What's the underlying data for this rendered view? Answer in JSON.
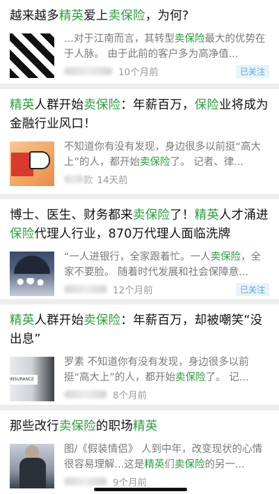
{
  "articles": [
    {
      "title_parts": [
        {
          "t": "越来越多",
          "hl": false
        },
        {
          "t": "精英",
          "hl": true
        },
        {
          "t": "爱上",
          "hl": false
        },
        {
          "t": "卖保险",
          "hl": true
        },
        {
          "t": "，为何?",
          "hl": false
        }
      ],
      "snippet_parts": [
        {
          "t": "...对于江南而言，其转型",
          "hl": false
        },
        {
          "t": "卖保险",
          "hl": true
        },
        {
          "t": "最大的优势在于人脉。 由于此前的客户多为高净值...",
          "hl": false
        }
      ],
      "time": "10个月前",
      "badge": "已关注",
      "thumb": "black-white-stripes-image"
    },
    {
      "title_parts": [
        {
          "t": "精英",
          "hl": true
        },
        {
          "t": "人群开始",
          "hl": false
        },
        {
          "t": "卖保险",
          "hl": true
        },
        {
          "t": "：年薪百万，",
          "hl": false
        },
        {
          "t": "保险",
          "hl": true
        },
        {
          "t": "业将成为金融行业风口！",
          "hl": false
        }
      ],
      "snippet_parts": [
        {
          "t": "不知道你有没有发现，身边很多以前挺“高大上”的人，都开始",
          "hl": false
        },
        {
          "t": "卖保险",
          "hl": true
        },
        {
          "t": "了。 记者、律...",
          "hl": false
        }
      ],
      "source_suffix": "款",
      "time": "14天前",
      "badge": "",
      "thumb": "megaphone-sign-image"
    },
    {
      "title_parts": [
        {
          "t": "博士、医生、财务都来",
          "hl": false
        },
        {
          "t": "卖保险",
          "hl": true
        },
        {
          "t": "了！",
          "hl": false
        },
        {
          "t": "精英",
          "hl": true
        },
        {
          "t": "人才涌进",
          "hl": false
        },
        {
          "t": "保险",
          "hl": true
        },
        {
          "t": "代理人行业，870万代理人面临洗牌",
          "hl": false
        }
      ],
      "snippet_parts": [
        {
          "t": "“一人进银行，全家跟着忙。一人",
          "hl": false
        },
        {
          "t": "卖保险",
          "hl": true
        },
        {
          "t": "，全家不要脸。 随着时代发展和社会保障意...",
          "hl": false
        }
      ],
      "time": "12个月前",
      "badge": "已关注",
      "thumb": "umbrella-family-image"
    },
    {
      "title_parts": [
        {
          "t": "精英",
          "hl": true
        },
        {
          "t": "人群开始",
          "hl": false
        },
        {
          "t": "卖保险",
          "hl": true
        },
        {
          "t": "：年薪百万，却被嘲笑“没出息”",
          "hl": false
        }
      ],
      "snippet_parts": [
        {
          "t": "罗素 不知道你有没有发现，身边很多以前挺“高大上”的人，都开始",
          "hl": false
        },
        {
          "t": "卖保险",
          "hl": true
        },
        {
          "t": "了。 记...",
          "hl": false
        }
      ],
      "time": "8个月前",
      "badge": "",
      "thumb": "insurance-document-image",
      "thumb_text": "INSURANCE"
    },
    {
      "title_parts": [
        {
          "t": "那些改行",
          "hl": false
        },
        {
          "t": "卖保险",
          "hl": true
        },
        {
          "t": "的职场",
          "hl": false
        },
        {
          "t": "精英",
          "hl": true
        }
      ],
      "snippet_parts": [
        {
          "t": "图/《假装情侣》 人到中年，改变现状的心情很容易理解...这是",
          "hl": false
        },
        {
          "t": "精英",
          "hl": true
        },
        {
          "t": "们",
          "hl": false
        },
        {
          "t": "卖保险",
          "hl": true
        },
        {
          "t": "的另一...",
          "hl": false
        }
      ],
      "time": "9个月前",
      "badge": "",
      "thumb": "businessman-image"
    }
  ]
}
